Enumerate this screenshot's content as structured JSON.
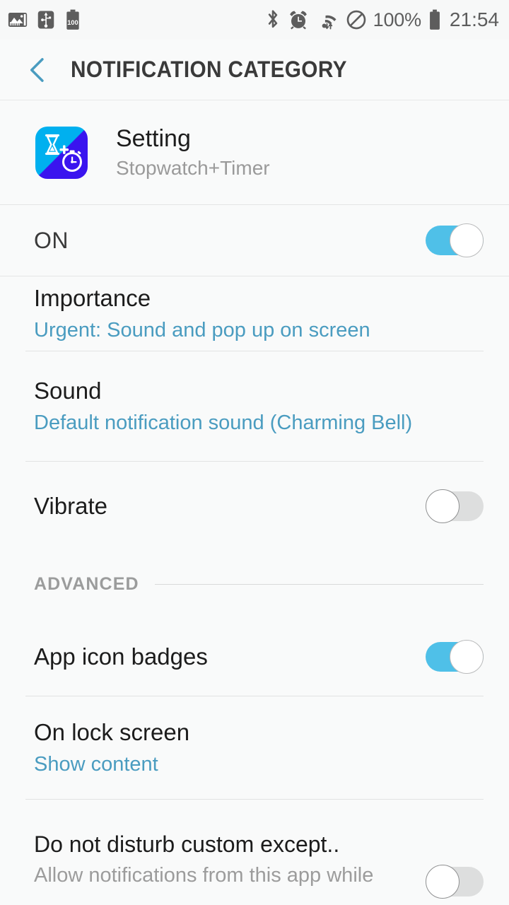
{
  "status_bar": {
    "left_icons": [
      "photo-icon",
      "usb-icon",
      "battery-100-icon"
    ],
    "right_icons": [
      "bluetooth-icon",
      "alarm-icon",
      "wifi-icon",
      "do-not-disturb-icon"
    ],
    "battery_percent": "100%",
    "time": "21:54"
  },
  "header": {
    "title": "NOTIFICATION CATEGORY",
    "back_icon": "chevron-left-icon",
    "accent_color": "#4a9cc0"
  },
  "app": {
    "name": "Setting",
    "subtitle": "Stopwatch+Timer",
    "icon": "hourglass-stopwatch-icon"
  },
  "settings": {
    "master_toggle": {
      "label": "ON",
      "state": "on"
    },
    "importance": {
      "title": "Importance",
      "value": "Urgent: Sound and pop up on screen"
    },
    "sound": {
      "title": "Sound",
      "value": "Default notification sound (Charming Bell)"
    },
    "vibrate": {
      "title": "Vibrate",
      "state": "off"
    },
    "advanced_section": {
      "label": "ADVANCED"
    },
    "app_icon_badges": {
      "title": "App icon badges",
      "state": "on"
    },
    "on_lock_screen": {
      "title": "On lock screen",
      "value": "Show content"
    },
    "do_not_disturb": {
      "title": "Do not disturb custom except..",
      "value": "Allow notifications from this app while",
      "state": "off"
    }
  },
  "colors": {
    "accent": "#4fc0e8",
    "link": "#4a9cc0",
    "background": "#f9fafa",
    "text": "#1c1c1c",
    "muted": "#9a9a9a"
  }
}
